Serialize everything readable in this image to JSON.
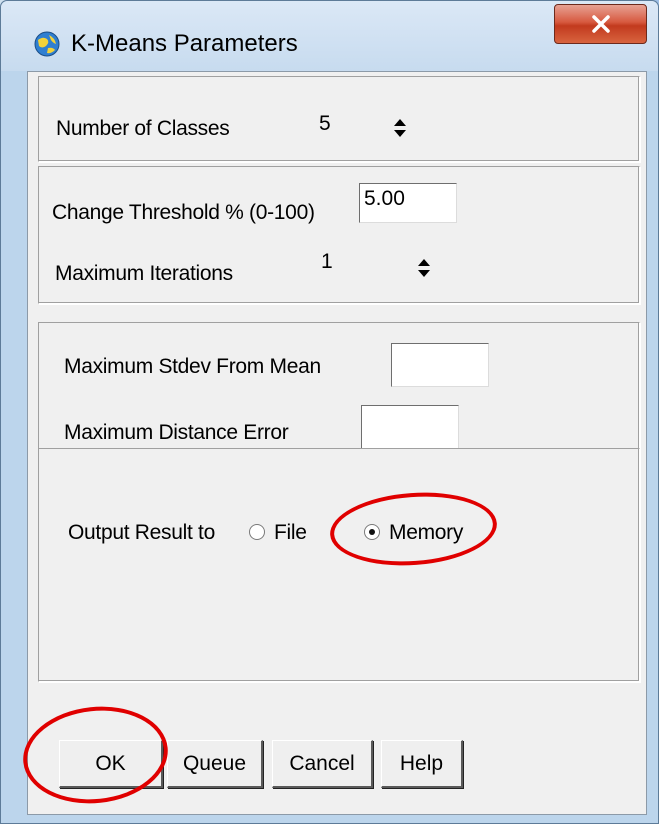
{
  "window": {
    "title": "K-Means Parameters",
    "close_label": "X"
  },
  "classes": {
    "label": "Number of Classes",
    "value": "5"
  },
  "threshold": {
    "label": "Change Threshold % (0-100)",
    "value": "5.00"
  },
  "iterations": {
    "label": "Maximum Iterations",
    "value": "1"
  },
  "stdev": {
    "label": "Maximum Stdev From Mean",
    "value": ""
  },
  "distance": {
    "label": "Maximum Distance Error",
    "value": ""
  },
  "output": {
    "label": "Output Result to",
    "options": [
      "File",
      "Memory"
    ],
    "selected": "Memory"
  },
  "buttons": {
    "ok": "OK",
    "queue": "Queue",
    "cancel": "Cancel",
    "help": "Help"
  },
  "colors": {
    "annotation": "#e00000",
    "close_button": "#c9452a"
  }
}
